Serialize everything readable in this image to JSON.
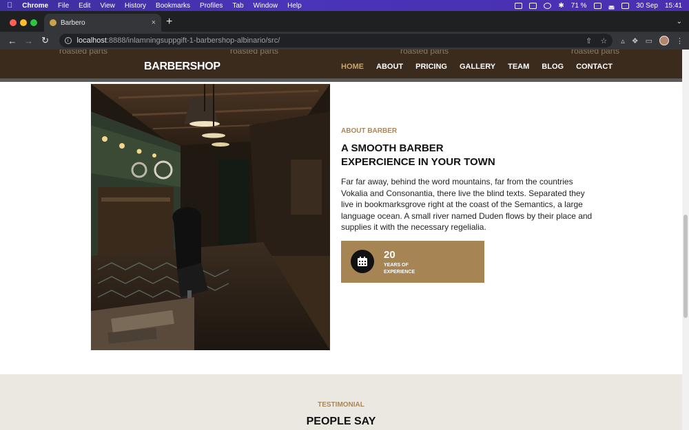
{
  "mac_menubar": {
    "app_name": "Chrome",
    "menus": [
      "File",
      "Edit",
      "View",
      "History",
      "Bookmarks",
      "Profiles",
      "Tab",
      "Window",
      "Help"
    ],
    "battery": "71 %",
    "date": "30 Sep",
    "time": "15:41"
  },
  "browser": {
    "tab_title": "Barbero",
    "url_host": "localhost",
    "url_path": ":8888/inlamningsuppgift-1-barbershop-albinario/src/"
  },
  "site": {
    "faded_items": [
      "roasted parts",
      "roasted parts",
      "roasted parts",
      "roasted parts"
    ],
    "logo": "BARBERSHOP",
    "nav": [
      "HOME",
      "ABOUT",
      "PRICING",
      "GALLERY",
      "TEAM",
      "BLOG",
      "CONTACT"
    ],
    "nav_active_index": 0,
    "accent_color": "#a68454",
    "header_bg": "#3a2b1c"
  },
  "about": {
    "label": "ABOUT BARBER",
    "title": "A SMOOTH BARBER EXPERCIENCE IN YOUR TOWN",
    "text": "Far far away, behind the word mountains, far from the countries Vokalia and Consonantia, there live the blind texts. Separated they live in bookmarksgrove right at the coast of the Semantics, a large language ocean. A small river named Duden flows by their place and supplies it with the necessary regelialia.",
    "experience_number": "20",
    "experience_label": "YEARS OF EXPERIENCE",
    "experience_icon": "calendar-icon"
  },
  "testimonial": {
    "label": "TESTIMONIAL",
    "title": "PEOPLE SAY"
  }
}
